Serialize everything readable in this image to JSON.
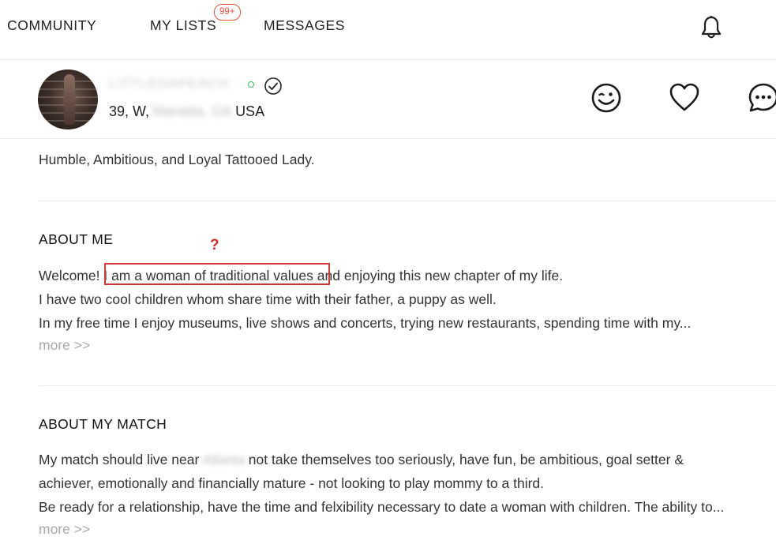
{
  "nav": {
    "community": "COMMUNITY",
    "my_lists": "MY LISTS",
    "my_lists_badge": "99+",
    "messages": "MESSAGES"
  },
  "profile": {
    "username": "LITTLEGAPEACH",
    "age_gender": "39, W,",
    "city_state": "Marietta, GA",
    "country": "USA",
    "status_color": "#3cbc5c",
    "tagline": "Humble, Ambitious, and Loyal Tattooed Lady."
  },
  "about_me": {
    "heading": "ABOUT ME",
    "line1_pre": "Welcome! ",
    "line1_highlight": "I am a woman of traditional values",
    "line1_post": " and enjoying this new chapter of my life.",
    "line2": "I have two cool children whom share time with their father, a puppy as well.",
    "line3": "In my free time I enjoy museums, live shows and concerts, trying new restaurants, spending time with my...",
    "more": "more >>"
  },
  "annotation": {
    "question_mark": "?",
    "highlight_color": "#cd3b3b"
  },
  "about_match": {
    "heading": "ABOUT MY MATCH",
    "line1_pre": "My match should live near",
    "line1_blurred": "Atlanta",
    "line1_post": "not take themselves too seriously, have fun, be ambitious, goal setter &",
    "line2": "achiever, emotionally and financially mature - not looking to play mommy to a third.",
    "line3": "Be ready for a relationship, have the time and felxibility necessary to date a woman with children. The ability to...",
    "more": "more >>"
  },
  "icons": {
    "bell": "bell-icon",
    "verified": "check-circle-icon",
    "wink": "wink-icon",
    "heart": "heart-icon",
    "chat": "chat-bubble-icon"
  },
  "colors": {
    "accent": "#e3503c"
  }
}
